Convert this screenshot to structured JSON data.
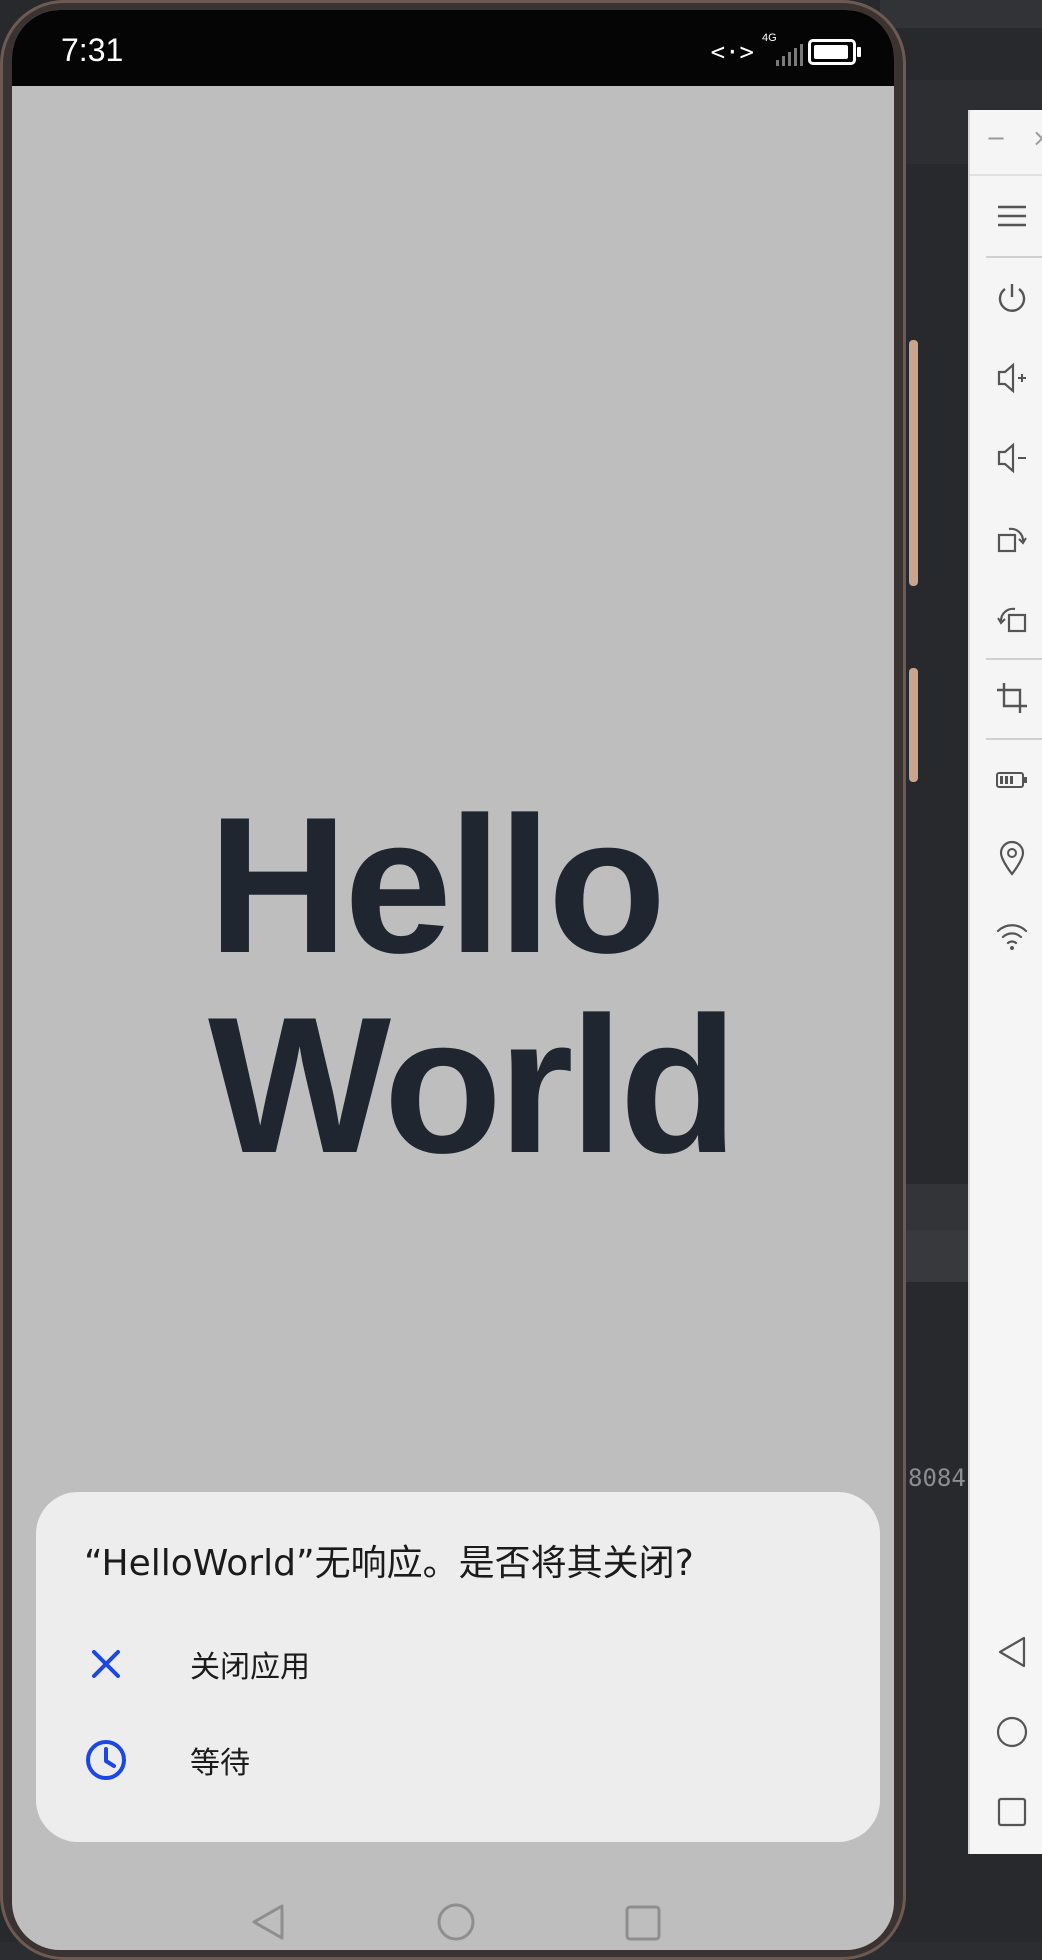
{
  "status_bar": {
    "time": "7:31",
    "data_activity": "<·>",
    "network_label": "4G",
    "battery_level": 0.95
  },
  "app": {
    "hello_line1": "Hello",
    "hello_line2": "World"
  },
  "anr_dialog": {
    "title": "“HelloWorld”无响应。是否将其关闭?",
    "options": [
      {
        "label": "关闭应用",
        "icon": "close-icon"
      },
      {
        "label": "等待",
        "icon": "clock-icon"
      }
    ],
    "accent_color": "#1a47e6"
  },
  "emulator_toolbar": {
    "minimize": "−",
    "close": "×",
    "buttons": [
      "menu-icon",
      "power-icon",
      "volume-up-icon",
      "volume-down-icon",
      "rotate-left-icon",
      "rotate-right-icon",
      "crop-icon",
      "battery-icon",
      "location-icon",
      "wifi-icon",
      "back-icon",
      "home-icon",
      "recents-icon"
    ]
  },
  "ide": {
    "partial_text": "8084"
  }
}
